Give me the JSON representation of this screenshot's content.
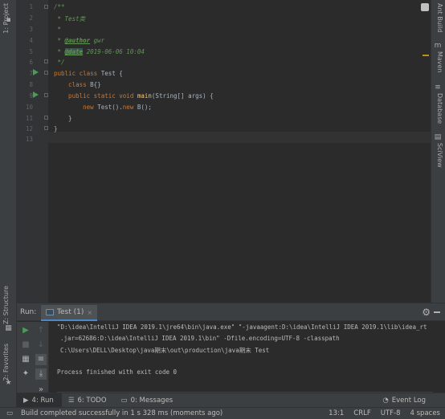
{
  "left_strip": {
    "top_tab": "1: Project",
    "structure_tab": "Z: Structure",
    "favorites_tab": "2: Favorites"
  },
  "right_strip": {
    "tabs": [
      "Ant Build",
      "Maven",
      "Database",
      "SciView"
    ]
  },
  "editor": {
    "line_numbers": [
      "1",
      "2",
      "3",
      "4",
      "5",
      "6",
      "7",
      "8",
      "9",
      "10",
      "11",
      "12",
      "13"
    ],
    "code": {
      "l1": "/**",
      "l2a": " * ",
      "l2b": "Test类",
      "l3": " *",
      "l4a": " * ",
      "l4tag": "@author",
      "l4b": " gwr",
      "l5a": " * ",
      "l5tag": "@date",
      "l5b": " 2019-06-06 10:04",
      "l6": " */",
      "l7kw": "public class ",
      "l7b": "Test {",
      "l8kw": "    class ",
      "l8b": "B{}",
      "l9kw": "    public static void ",
      "l9fn": "main",
      "l9b": "(String[] args) {",
      "l10kw": "        new ",
      "l10b": "Test().",
      "l10kw2": "new ",
      "l10c": "B();",
      "l11": "    }",
      "l12": "}"
    }
  },
  "run_panel": {
    "title": "Run:",
    "tab_label": "Test (1)",
    "tab_close": "×",
    "console_lines": [
      "\"D:\\idea\\IntelliJ IDEA 2019.1\\jre64\\bin\\java.exe\" \"-javaagent:D:\\idea\\IntelliJ IDEA 2019.1\\lib\\idea_rt",
      ".jar=62686:D:\\idea\\IntelliJ IDEA 2019.1\\bin\" -Dfile.encoding=UTF-8 -classpath",
      "C:\\Users\\DELL\\Desktop\\java期末\\out\\production\\java期末 Test",
      "",
      "Process finished with exit code 0"
    ]
  },
  "tool_tabs": {
    "run": "4: Run",
    "todo": "6: TODO",
    "messages": "0: Messages",
    "event_log": "Event Log"
  },
  "status_bar": {
    "message": "Build completed successfully in 1 s 328 ms (moments ago)",
    "position": "13:1",
    "line_sep": "CRLF",
    "encoding": "UTF-8",
    "indent": "4 spaces"
  },
  "colors": {
    "background": "#2b2b2b",
    "panel": "#3c3f41",
    "keyword": "#cc7832",
    "doc_comment": "#629755",
    "method": "#ffc66d",
    "run_green": "#499c54"
  }
}
